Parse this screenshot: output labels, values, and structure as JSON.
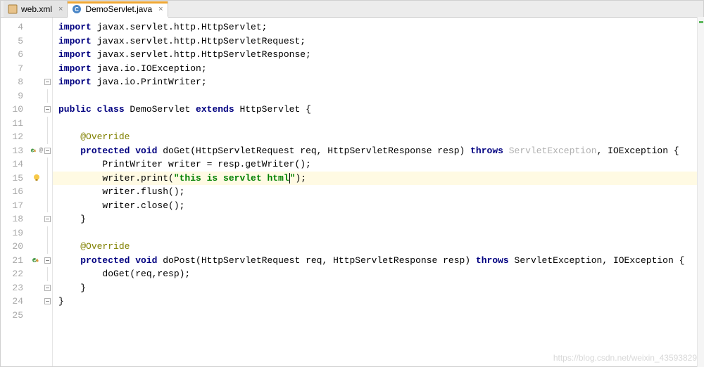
{
  "tabs": [
    {
      "label": "web.xml",
      "active": false
    },
    {
      "label": "DemoServlet.java",
      "active": true
    }
  ],
  "lines": {
    "4": {
      "tokens": [
        [
          "kw",
          "import"
        ],
        [
          "",
          " javax.servlet.http.HttpServlet;"
        ]
      ]
    },
    "5": {
      "tokens": [
        [
          "kw",
          "import"
        ],
        [
          "",
          " javax.servlet.http.HttpServletRequest;"
        ]
      ]
    },
    "6": {
      "tokens": [
        [
          "kw",
          "import"
        ],
        [
          "",
          " javax.servlet.http.HttpServletResponse;"
        ]
      ]
    },
    "7": {
      "tokens": [
        [
          "kw",
          "import"
        ],
        [
          "",
          " java.io.IOException;"
        ]
      ]
    },
    "8": {
      "tokens": [
        [
          "kw",
          "import"
        ],
        [
          "",
          " java.io.PrintWriter;"
        ]
      ]
    },
    "9": {
      "tokens": []
    },
    "10": {
      "tokens": [
        [
          "kw",
          "public class"
        ],
        [
          "",
          " DemoServlet "
        ],
        [
          "kw",
          "extends"
        ],
        [
          "",
          " HttpServlet {"
        ]
      ]
    },
    "11": {
      "tokens": []
    },
    "12": {
      "indent": 1,
      "tokens": [
        [
          "ann",
          "@Override"
        ]
      ]
    },
    "13": {
      "indent": 1,
      "tokens": [
        [
          "kw",
          "protected void"
        ],
        [
          "",
          " doGet(HttpServletRequest req, HttpServletResponse resp) "
        ],
        [
          "kw",
          "throws"
        ],
        [
          "",
          " "
        ],
        [
          "grey",
          "ServletException"
        ],
        [
          "",
          ", IOException {"
        ]
      ]
    },
    "14": {
      "indent": 2,
      "tokens": [
        [
          "",
          "PrintWriter writer = resp.getWriter();"
        ]
      ]
    },
    "15": {
      "indent": 2,
      "tokens": [
        [
          "",
          "writer.print("
        ],
        [
          "str",
          "\"this is servlet html\""
        ],
        [
          "",
          ");"
        ]
      ],
      "highlight": true,
      "cursorAfter": "\"this is servlet html"
    },
    "16": {
      "indent": 2,
      "tokens": [
        [
          "",
          "writer.flush();"
        ]
      ]
    },
    "17": {
      "indent": 2,
      "tokens": [
        [
          "",
          "writer.close();"
        ]
      ]
    },
    "18": {
      "indent": 1,
      "tokens": [
        [
          "",
          "}"
        ]
      ]
    },
    "19": {
      "tokens": []
    },
    "20": {
      "indent": 1,
      "tokens": [
        [
          "ann",
          "@Override"
        ]
      ]
    },
    "21": {
      "indent": 1,
      "tokens": [
        [
          "kw",
          "protected void"
        ],
        [
          "",
          " doPost(HttpServletRequest req, HttpServletResponse resp) "
        ],
        [
          "kw",
          "throws"
        ],
        [
          "",
          " ServletException, IOException {"
        ]
      ]
    },
    "22": {
      "indent": 2,
      "tokens": [
        [
          "",
          "doGet(req,resp);"
        ]
      ]
    },
    "23": {
      "indent": 1,
      "tokens": [
        [
          "",
          "}"
        ]
      ]
    },
    "24": {
      "tokens": [
        [
          "",
          "}"
        ]
      ]
    },
    "25": {
      "tokens": []
    }
  },
  "lineStart": 4,
  "lineEnd": 25,
  "gutterMarks": {
    "13": "override-impl",
    "15": "bulb",
    "21": "override"
  },
  "foldMarks": {
    "8": "minus-end",
    "10": "minus",
    "13": "minus",
    "18": "minus-end",
    "21": "minus",
    "23": "minus-end",
    "24": "minus-end"
  },
  "watermark": "https://blog.csdn.net/weixin_43593829"
}
